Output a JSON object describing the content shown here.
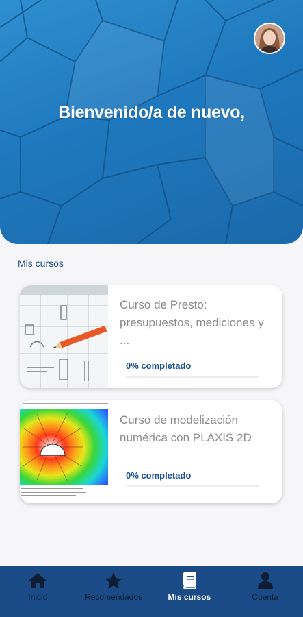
{
  "header": {
    "welcome_text": "Bienvenido/a de nuevo,"
  },
  "section": {
    "title": "Mis cursos"
  },
  "courses": [
    {
      "title": "Curso de Presto: presupuestos, mediciones y ...",
      "progress_label": "0% completado",
      "progress": 0
    },
    {
      "title": "Curso de modelización numérica con PLAXIS 2D",
      "progress_label": "0% completado",
      "progress": 0
    }
  ],
  "bottom_nav": {
    "items": [
      {
        "label": "Inicio",
        "icon": "home-icon",
        "active": false
      },
      {
        "label": "Recomendados",
        "icon": "star-icon",
        "active": false
      },
      {
        "label": "Mis cursos",
        "icon": "book-icon",
        "active": true
      },
      {
        "label": "Cuenta",
        "icon": "user-icon",
        "active": false
      }
    ]
  },
  "colors": {
    "primary": "#1b4f8f",
    "nav_bg": "#1b4b87",
    "hero": "#2a86c8"
  }
}
